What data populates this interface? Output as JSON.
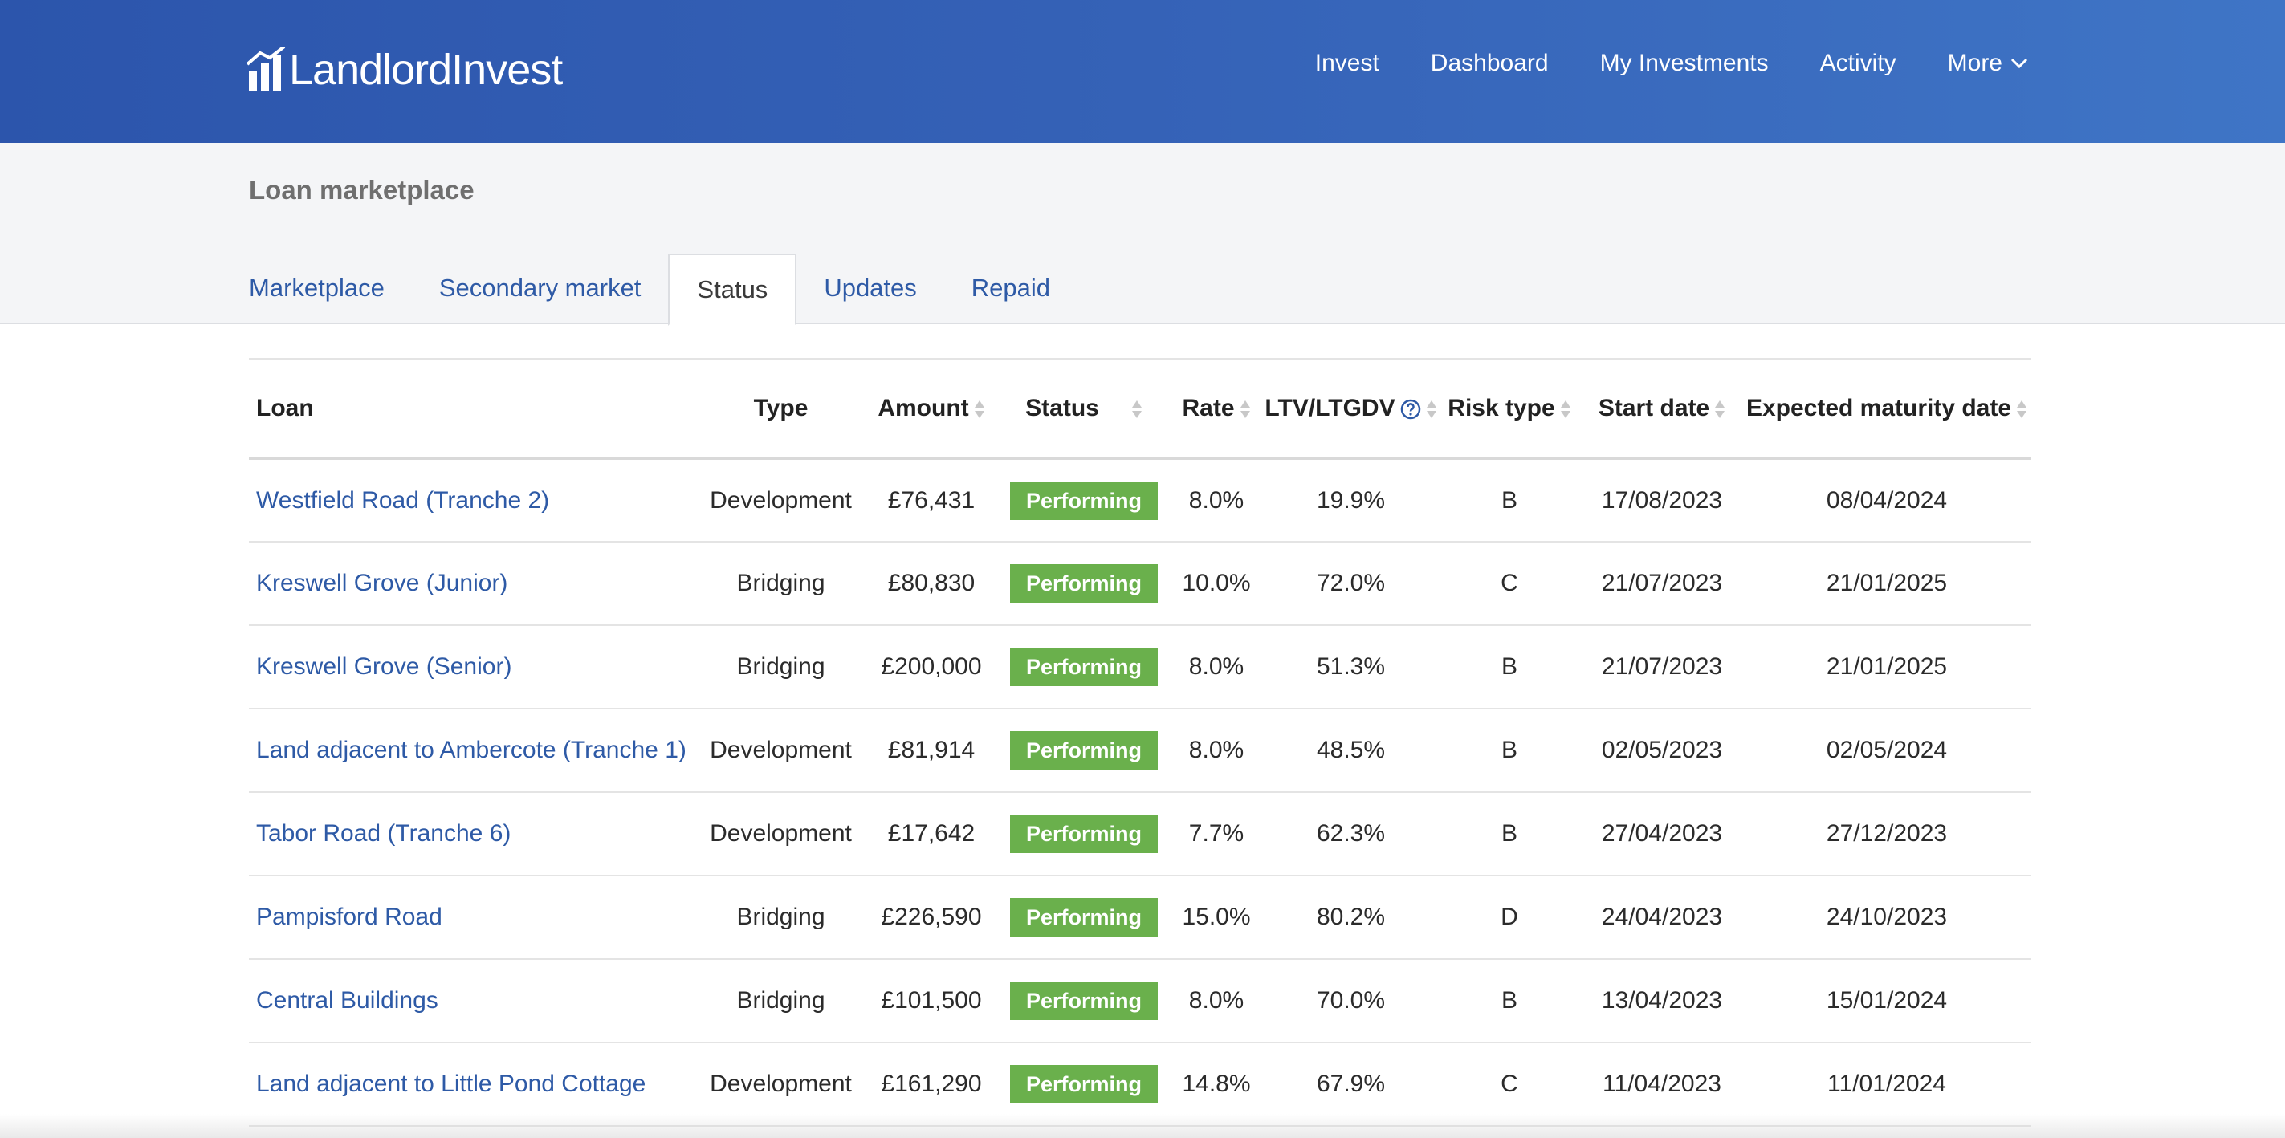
{
  "brand": {
    "name": "LandlordInvest"
  },
  "nav": [
    {
      "label": "Invest"
    },
    {
      "label": "Dashboard"
    },
    {
      "label": "My Investments"
    },
    {
      "label": "Activity"
    },
    {
      "label": "More"
    }
  ],
  "page": {
    "title": "Loan marketplace"
  },
  "tabs": [
    {
      "label": "Marketplace",
      "active": false
    },
    {
      "label": "Secondary market",
      "active": false
    },
    {
      "label": "Status",
      "active": true
    },
    {
      "label": "Updates",
      "active": false
    },
    {
      "label": "Repaid",
      "active": false
    }
  ],
  "table": {
    "headers": {
      "loan": "Loan",
      "type": "Type",
      "amount": "Amount",
      "status": "Status",
      "rate": "Rate",
      "ltv": "LTV/LTGDV",
      "risk": "Risk type",
      "start": "Start date",
      "maturity": "Expected maturity date"
    },
    "rows": [
      {
        "loan": "Westfield Road (Tranche 2)",
        "type": "Development",
        "amount": "£76,431",
        "status": "Performing",
        "rate": "8.0%",
        "ltv": "19.9%",
        "risk": "B",
        "start": "17/08/2023",
        "maturity": "08/04/2024"
      },
      {
        "loan": "Kreswell Grove (Junior)",
        "type": "Bridging",
        "amount": "£80,830",
        "status": "Performing",
        "rate": "10.0%",
        "ltv": "72.0%",
        "risk": "C",
        "start": "21/07/2023",
        "maturity": "21/01/2025"
      },
      {
        "loan": "Kreswell Grove (Senior)",
        "type": "Bridging",
        "amount": "£200,000",
        "status": "Performing",
        "rate": "8.0%",
        "ltv": "51.3%",
        "risk": "B",
        "start": "21/07/2023",
        "maturity": "21/01/2025"
      },
      {
        "loan": "Land adjacent to Ambercote (Tranche 1)",
        "type": "Development",
        "amount": "£81,914",
        "status": "Performing",
        "rate": "8.0%",
        "ltv": "48.5%",
        "risk": "B",
        "start": "02/05/2023",
        "maturity": "02/05/2024"
      },
      {
        "loan": "Tabor Road (Tranche 6)",
        "type": "Development",
        "amount": "£17,642",
        "status": "Performing",
        "rate": "7.7%",
        "ltv": "62.3%",
        "risk": "B",
        "start": "27/04/2023",
        "maturity": "27/12/2023"
      },
      {
        "loan": "Pampisford Road",
        "type": "Bridging",
        "amount": "£226,590",
        "status": "Performing",
        "rate": "15.0%",
        "ltv": "80.2%",
        "risk": "D",
        "start": "24/04/2023",
        "maturity": "24/10/2023"
      },
      {
        "loan": "Central Buildings",
        "type": "Bridging",
        "amount": "£101,500",
        "status": "Performing",
        "rate": "8.0%",
        "ltv": "70.0%",
        "risk": "B",
        "start": "13/04/2023",
        "maturity": "15/01/2024"
      },
      {
        "loan": "Land adjacent to Little Pond Cottage",
        "type": "Development",
        "amount": "£161,290",
        "status": "Performing",
        "rate": "14.8%",
        "ltv": "67.9%",
        "risk": "C",
        "start": "11/04/2023",
        "maturity": "11/01/2024"
      }
    ]
  },
  "colors": {
    "header_start": "#2c55ac",
    "header_end": "#3f75c6",
    "link": "#2e5aa6",
    "status_performing": "#6ab04c"
  },
  "icons": {
    "logo": "bar-chart-icon",
    "more": "chevron-down-icon",
    "sort": "sort-icon",
    "help": "question-circle-icon"
  }
}
